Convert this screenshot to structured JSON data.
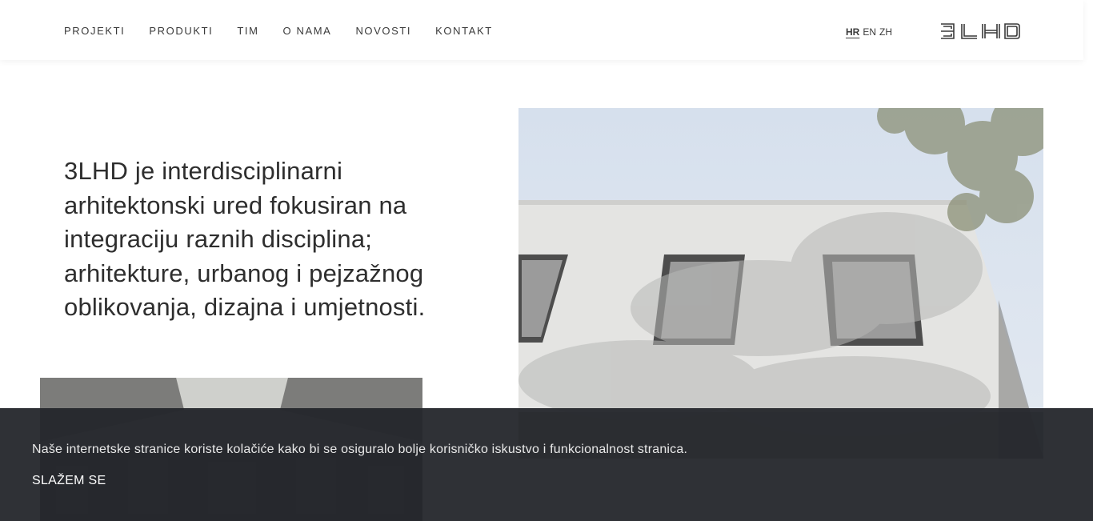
{
  "nav": {
    "items": [
      {
        "label": "PROJEKTI"
      },
      {
        "label": "PRODUKTI"
      },
      {
        "label": "TIM"
      },
      {
        "label": "O NAMA"
      },
      {
        "label": "NOVOSTI"
      },
      {
        "label": "KONTAKT"
      }
    ]
  },
  "languages": [
    {
      "label": "HR",
      "active": true
    },
    {
      "label": "EN",
      "active": false
    },
    {
      "label": "ZH",
      "active": false
    }
  ],
  "logo": {
    "text": "3LHD",
    "icon": "3lhd-logo-icon"
  },
  "intro": {
    "text": "3LHD je interdisciplinarni arhitektonski ured fokusiran na integraciju raznih disciplina; arhitekture, urbanog i pejzažnog oblikovanja, dizajna i umjetnosti."
  },
  "images": {
    "right": "building-facade-with-tree-shadows",
    "left": "interior-hall-with-skylight"
  },
  "cookie": {
    "text": "Naše internetske stranice koriste kolačiće kako bi se osiguralo bolje korisničko iskustvo i funkcionalnost stranica.",
    "accept_label": "SLAŽEM SE"
  },
  "colors": {
    "cookie_bg": "#24262b",
    "text": "#2e2e2e"
  }
}
